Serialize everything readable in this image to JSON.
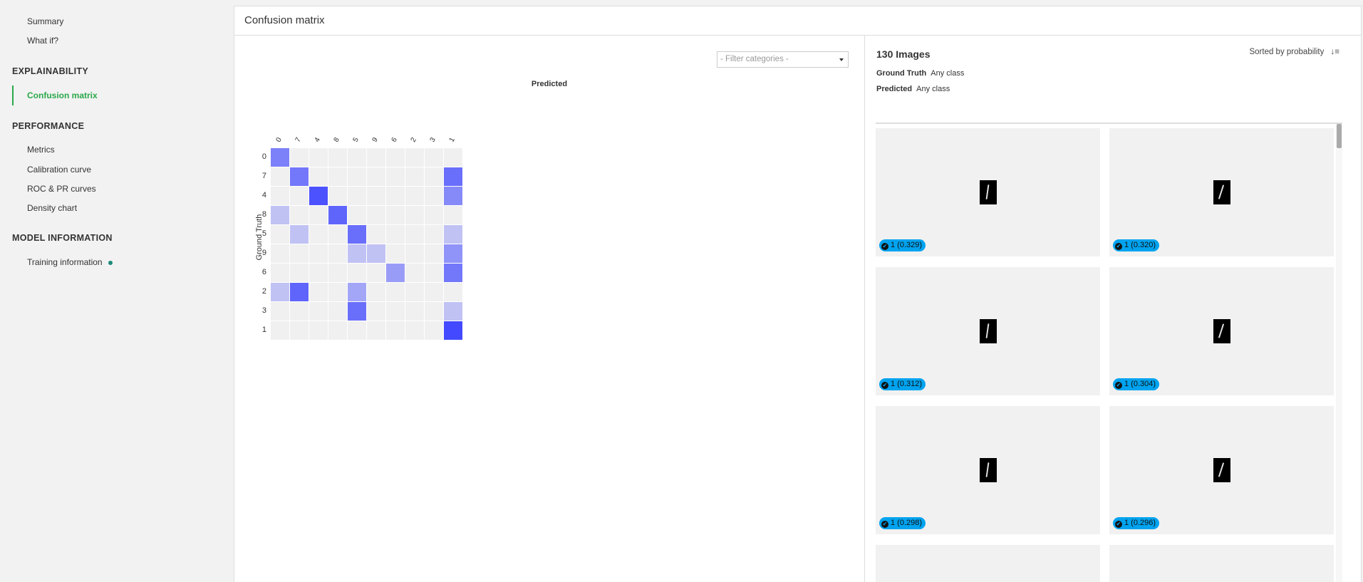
{
  "sidebar": {
    "top_items": [
      "Summary",
      "What if?"
    ],
    "sections": [
      {
        "title": "EXPLAINABILITY",
        "items": [
          "Confusion matrix"
        ],
        "active": "Confusion matrix"
      },
      {
        "title": "PERFORMANCE",
        "items": [
          "Metrics",
          "Calibration curve",
          "ROC & PR curves",
          "Density chart"
        ]
      },
      {
        "title": "MODEL INFORMATION",
        "items": [
          "Training information"
        ]
      }
    ],
    "accent": "#2aa84a"
  },
  "header": {
    "title": "Confusion matrix"
  },
  "matrix": {
    "filter_placeholder": "- Filter categories -",
    "xlabel": "Predicted",
    "ylabel": "Ground Truth"
  },
  "chart_data": {
    "type": "heatmap",
    "xlabel": "Predicted",
    "ylabel": "Ground Truth",
    "categories": [
      "0",
      "7",
      "4",
      "8",
      "5",
      "9",
      "6",
      "2",
      "3",
      "1"
    ],
    "rows": [
      "0",
      "7",
      "4",
      "8",
      "5",
      "9",
      "6",
      "2",
      "3",
      "1"
    ],
    "intensity": [
      [
        0.6,
        0,
        0,
        0,
        0,
        0,
        0,
        0,
        0,
        0
      ],
      [
        0,
        0.65,
        0,
        0,
        0,
        0,
        0,
        0,
        0,
        0.7
      ],
      [
        0,
        0,
        0.85,
        0,
        0,
        0,
        0,
        0,
        0,
        0.55
      ],
      [
        0.25,
        0,
        0,
        0.75,
        0,
        0,
        0,
        0,
        0,
        0
      ],
      [
        0,
        0.25,
        0,
        0,
        0.7,
        0,
        0,
        0,
        0,
        0.25
      ],
      [
        0,
        0,
        0,
        0,
        0.25,
        0.25,
        0,
        0,
        0,
        0.5
      ],
      [
        0,
        0,
        0,
        0,
        0,
        0,
        0.45,
        0,
        0,
        0.65
      ],
      [
        0.25,
        0.75,
        0,
        0,
        0.4,
        0,
        0,
        0,
        0,
        0
      ],
      [
        0,
        0,
        0,
        0,
        0.7,
        0,
        0,
        0,
        0,
        0.25
      ],
      [
        0,
        0,
        0,
        0,
        0,
        0,
        0,
        0,
        0,
        0.9
      ]
    ],
    "color_low": "#f0f0f0",
    "color_high": "#2f36ff"
  },
  "gallery": {
    "count": "130 Images",
    "sort_label": "Sorted by probability",
    "ground_truth_label": "Ground Truth",
    "ground_truth_value": "Any class",
    "predicted_label": "Predicted",
    "predicted_value": "Any class",
    "badge_color": "#00a3ef",
    "cards": [
      {
        "label": "1 (0.329)"
      },
      {
        "label": "1 (0.320)"
      },
      {
        "label": "1 (0.312)"
      },
      {
        "label": "1 (0.304)"
      },
      {
        "label": "1 (0.298)"
      },
      {
        "label": "1 (0.296)"
      }
    ]
  }
}
